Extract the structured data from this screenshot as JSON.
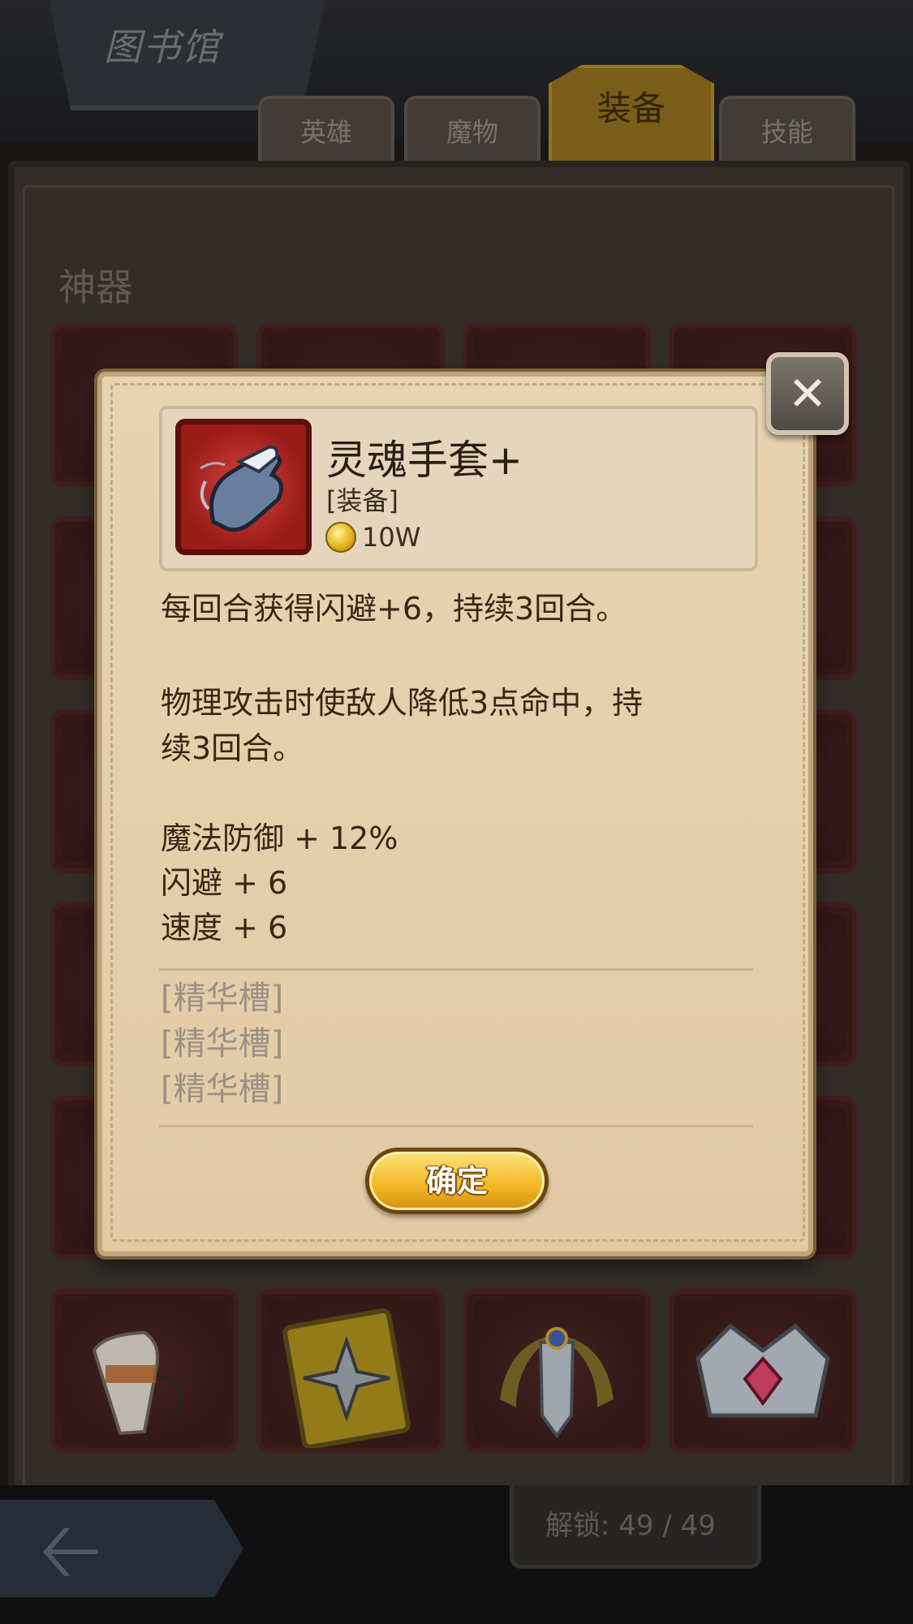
{
  "screen": {
    "title": "图书馆"
  },
  "tabs": [
    {
      "label": "英雄",
      "active": false
    },
    {
      "label": "魔物",
      "active": false
    },
    {
      "label": "装备",
      "active": true
    },
    {
      "label": "技能",
      "active": false
    }
  ],
  "section": {
    "title": "神器"
  },
  "footer": {
    "unlock_text": "解锁: 49 / 49",
    "back_icon": "back-arrow-icon"
  },
  "dialog": {
    "item": {
      "name": "灵魂手套+",
      "type": "[装备]",
      "price": "10W",
      "icon": "soul-gauntlet-icon",
      "currency_icon": "gold-coin-icon"
    },
    "description": [
      "每回合获得闪避+6，持续3回合。",
      "物理攻击时使敌人降低3点命中，持",
      "续3回合。"
    ],
    "stats": [
      "魔法防御 + 12%",
      "闪避 + 6",
      "速度 + 6"
    ],
    "essence_slots": [
      "[精华槽]",
      "[精华槽]",
      "[精华槽]"
    ],
    "confirm_label": "确定",
    "close_icon": "close-icon"
  },
  "colors": {
    "dialog_bg": "#e6d1ae",
    "slot_frame": "#4a2320",
    "active_tab": "#8a6a1c",
    "confirm_button": "#f2b724"
  }
}
